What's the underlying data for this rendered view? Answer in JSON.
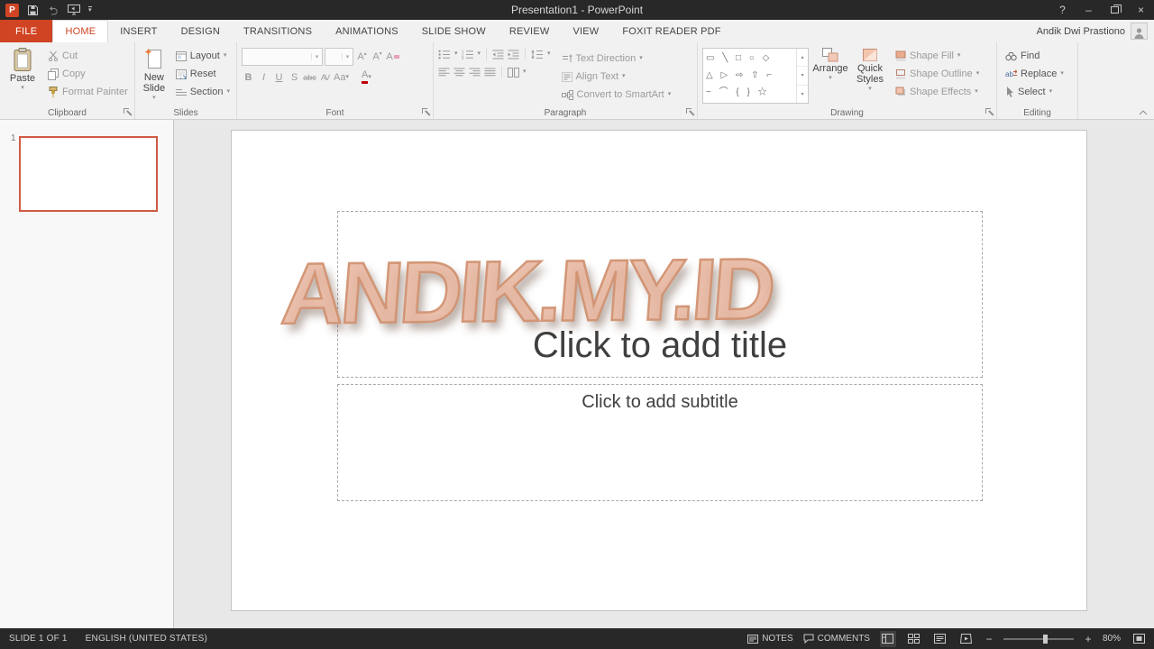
{
  "glyphs": {
    "dropdown": "▾",
    "up": "▴",
    "down": "▾"
  },
  "titlebar": {
    "logo": "P",
    "title": "Presentation1 - PowerPoint",
    "help": "?",
    "minimize": "–",
    "close": "×"
  },
  "tabs": {
    "file": "FILE",
    "home": "HOME",
    "insert": "INSERT",
    "design": "DESIGN",
    "transitions": "TRANSITIONS",
    "animations": "ANIMATIONS",
    "slide_show": "SLIDE SHOW",
    "review": "REVIEW",
    "view": "VIEW",
    "foxit": "FOXIT READER PDF",
    "user_name": "Andik Dwi Prastiono"
  },
  "ribbon": {
    "clipboard": {
      "label": "Clipboard",
      "paste": "Paste",
      "cut": "Cut",
      "copy": "Copy",
      "format_painter": "Format Painter"
    },
    "slides": {
      "label": "Slides",
      "new_slide": "New Slide",
      "layout": "Layout",
      "reset": "Reset",
      "section": "Section"
    },
    "font": {
      "label": "Font",
      "bold": "B",
      "italic": "I",
      "underline": "U",
      "shadow": "S",
      "strike": "abc",
      "char_spacing": "AV",
      "change_case": "Aa",
      "grow_font": "A",
      "shrink_font": "A",
      "clear_format": "A",
      "font_color": "A"
    },
    "paragraph": {
      "label": "Paragraph",
      "text_direction": "Text Direction",
      "align_text": "Align Text",
      "smartart": "Convert to SmartArt"
    },
    "drawing": {
      "label": "Drawing",
      "arrange": "Arrange",
      "quick_styles": "Quick Styles",
      "shape_fill": "Shape Fill",
      "shape_outline": "Shape Outline",
      "shape_effects": "Shape Effects",
      "shapes_row_1": "▭ ╲ □ ○ ◇",
      "shapes_row_2": "△ ▷ ⇨ ⇧ ⌐",
      "shapes_row_3": "~ ⌒ { } ☆"
    },
    "editing": {
      "label": "Editing",
      "find": "Find",
      "replace": "Replace",
      "select": "Select"
    }
  },
  "slides_panel": {
    "slide_number": "1"
  },
  "slide": {
    "title_placeholder": "Click to add title",
    "subtitle_placeholder": "Click to add subtitle",
    "watermark": "ANDIK.MY.ID"
  },
  "statusbar": {
    "slide_info": "SLIDE 1 OF 1",
    "language": "ENGLISH (UNITED STATES)",
    "notes": "NOTES",
    "comments": "COMMENTS",
    "zoom_out": "−",
    "zoom_in": "+",
    "zoom_level": "80%"
  }
}
